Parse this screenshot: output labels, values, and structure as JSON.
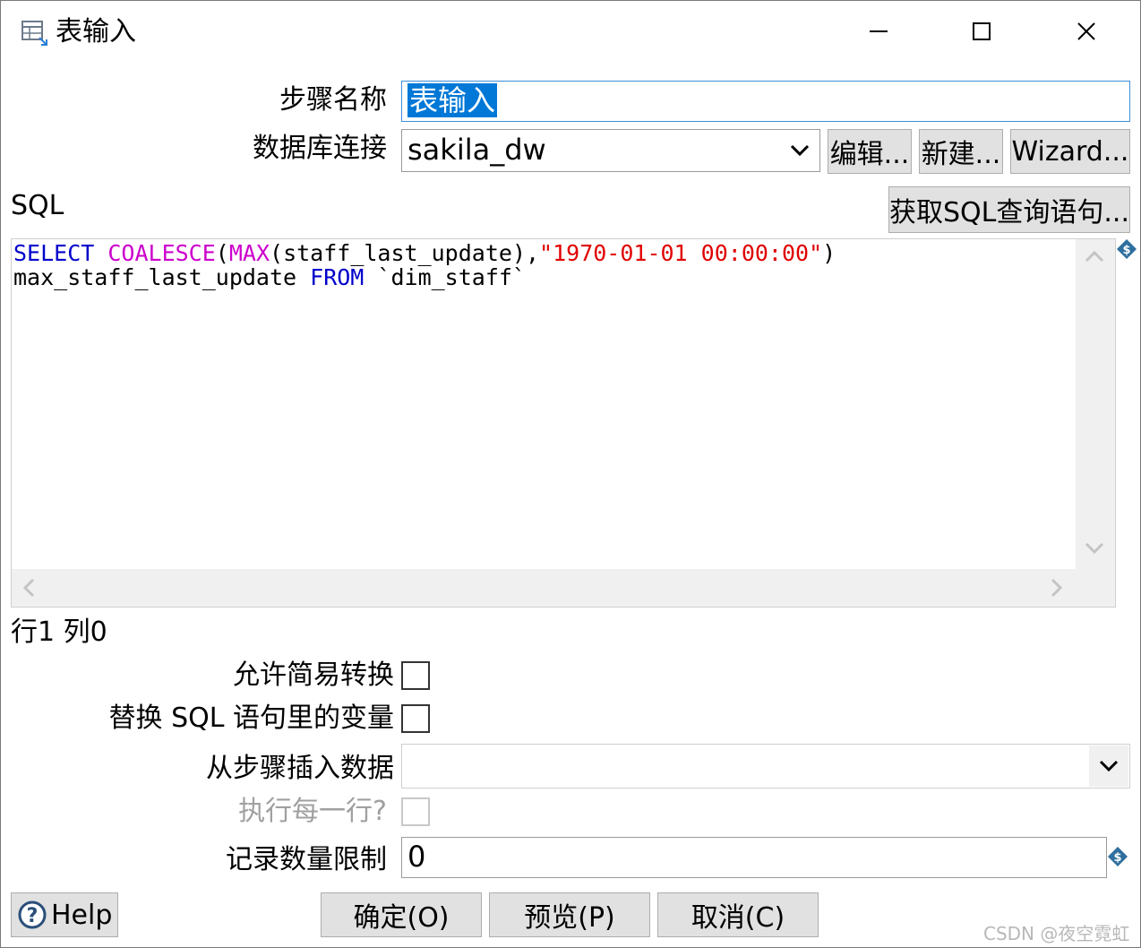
{
  "window": {
    "title": "表输入",
    "icon": "table-input-icon",
    "controls": [
      "minimize-icon",
      "maximize-icon",
      "close-icon"
    ]
  },
  "form": {
    "step_name_label": "步骤名称",
    "step_name_value": "表输入",
    "db_connection_label": "数据库连接",
    "db_connection_value": "sakila_dw",
    "edit_button": "编辑...",
    "new_button": "新建...",
    "wizard_button": "Wizard...",
    "sql_label": "SQL",
    "get_sql_button": "获取SQL查询语句..."
  },
  "sql": {
    "line1": {
      "kw_select": "SELECT",
      "fn_coalesce": "COALESCE",
      "paren_open": "(",
      "fn_max": "MAX",
      "args": "(staff_last_update),",
      "string_literal": "\"1970-01-01 00:00:00\"",
      "paren_close": ")"
    },
    "line2": {
      "alias": "max_staff_last_update ",
      "kw_from": "FROM",
      "table": " `dim_staff`"
    }
  },
  "status": {
    "position": "行1 列0"
  },
  "options": {
    "lazy_conversion_label": "允许简易转换",
    "lazy_conversion_checked": false,
    "replace_vars_label": "替换 SQL 语句里的变量",
    "replace_vars_checked": false,
    "insert_from_step_label": "从步骤插入数据",
    "insert_from_step_value": "",
    "execute_each_row_label": "执行每一行?",
    "execute_each_row_checked": false,
    "limit_label": "记录数量限制",
    "limit_value": "0"
  },
  "buttons": {
    "help": "Help",
    "ok": "确定(O)",
    "preview": "预览(P)",
    "cancel": "取消(C)"
  },
  "watermark": "CSDN @夜空霓虹",
  "colors": {
    "sql_keyword": "#0000cc",
    "sql_function": "#cc00cc",
    "sql_string": "#e00000",
    "selection": "#0078d7"
  }
}
